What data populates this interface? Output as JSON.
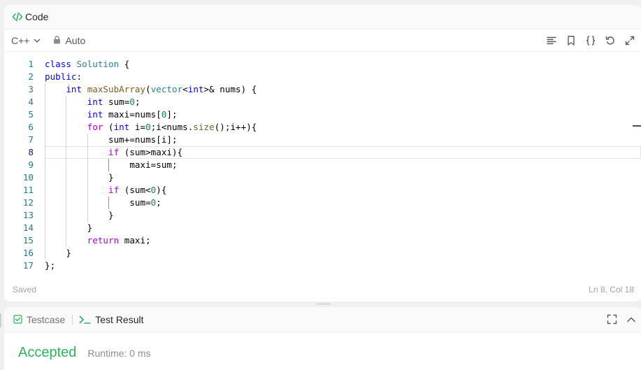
{
  "code_panel": {
    "title": "Code",
    "language": "C++",
    "mode": "Auto",
    "status": "Saved",
    "cursor_position": "Ln 8, Col 18",
    "current_line": 8
  },
  "code_lines": [
    {
      "num": "1",
      "indent": 0,
      "tokens": [
        {
          "t": "class",
          "c": "kw"
        },
        {
          "t": " "
        },
        {
          "t": "Solution",
          "c": "ty"
        },
        {
          "t": " {"
        }
      ]
    },
    {
      "num": "2",
      "indent": 0,
      "tokens": [
        {
          "t": "public",
          "c": "kw"
        },
        {
          "t": ":"
        }
      ]
    },
    {
      "num": "3",
      "indent": 1,
      "tokens": [
        {
          "t": "    "
        },
        {
          "t": "int",
          "c": "kw"
        },
        {
          "t": " "
        },
        {
          "t": "maxSubArray",
          "c": "fn"
        },
        {
          "t": "("
        },
        {
          "t": "vector",
          "c": "ty"
        },
        {
          "t": "<"
        },
        {
          "t": "int",
          "c": "kw"
        },
        {
          "t": ">& nums) {"
        }
      ]
    },
    {
      "num": "4",
      "indent": 2,
      "tokens": [
        {
          "t": "        "
        },
        {
          "t": "int",
          "c": "kw"
        },
        {
          "t": " sum="
        },
        {
          "t": "0",
          "c": "nm"
        },
        {
          "t": ";"
        }
      ]
    },
    {
      "num": "5",
      "indent": 2,
      "tokens": [
        {
          "t": "        "
        },
        {
          "t": "int",
          "c": "kw"
        },
        {
          "t": " maxi=nums["
        },
        {
          "t": "0",
          "c": "nm"
        },
        {
          "t": "];"
        }
      ]
    },
    {
      "num": "6",
      "indent": 2,
      "tokens": [
        {
          "t": "        "
        },
        {
          "t": "for",
          "c": "kwc"
        },
        {
          "t": " ("
        },
        {
          "t": "int",
          "c": "kw"
        },
        {
          "t": " i="
        },
        {
          "t": "0",
          "c": "nm"
        },
        {
          "t": ";i<nums."
        },
        {
          "t": "size",
          "c": "fn"
        },
        {
          "t": "();i++){"
        }
      ]
    },
    {
      "num": "7",
      "indent": 3,
      "tokens": [
        {
          "t": "            "
        },
        {
          "t": "sum+=nums[i];"
        }
      ]
    },
    {
      "num": "8",
      "indent": 3,
      "tokens": [
        {
          "t": "            "
        },
        {
          "t": "if",
          "c": "kwc"
        },
        {
          "t": " (sum>maxi){"
        }
      ]
    },
    {
      "num": "9",
      "indent": 4,
      "tokens": [
        {
          "t": "                "
        },
        {
          "t": "maxi=sum;"
        }
      ]
    },
    {
      "num": "10",
      "indent": 3,
      "tokens": [
        {
          "t": "            "
        },
        {
          "t": "}"
        }
      ]
    },
    {
      "num": "11",
      "indent": 3,
      "tokens": [
        {
          "t": "            "
        },
        {
          "t": "if",
          "c": "kwc"
        },
        {
          "t": " (sum<"
        },
        {
          "t": "0",
          "c": "nm"
        },
        {
          "t": "){"
        }
      ]
    },
    {
      "num": "12",
      "indent": 4,
      "tokens": [
        {
          "t": "                "
        },
        {
          "t": "sum="
        },
        {
          "t": "0",
          "c": "nm"
        },
        {
          "t": ";"
        }
      ]
    },
    {
      "num": "13",
      "indent": 3,
      "tokens": [
        {
          "t": "            "
        },
        {
          "t": "}"
        }
      ]
    },
    {
      "num": "14",
      "indent": 2,
      "tokens": [
        {
          "t": "        "
        },
        {
          "t": "}"
        }
      ]
    },
    {
      "num": "15",
      "indent": 2,
      "tokens": [
        {
          "t": "        "
        },
        {
          "t": "return",
          "c": "kwc"
        },
        {
          "t": " maxi;"
        }
      ]
    },
    {
      "num": "16",
      "indent": 1,
      "tokens": [
        {
          "t": "    "
        },
        {
          "t": "}"
        }
      ]
    },
    {
      "num": "17",
      "indent": 0,
      "tokens": [
        {
          "t": "};"
        }
      ]
    }
  ],
  "result_panel": {
    "tab_testcase": "Testcase",
    "tab_result": "Test Result",
    "verdict": "Accepted",
    "runtime": "Runtime: 0 ms"
  },
  "colors": {
    "accent_green": "#2db55d",
    "keyword_blue": "#0000ff",
    "control_purple": "#af00db",
    "type_teal": "#267f99",
    "function_brown": "#795e26",
    "number_green": "#098658",
    "line_number": "#237893"
  },
  "icons": {
    "code": "code-brackets-icon",
    "language_dropdown": "chevron-down-icon",
    "lock": "lock-icon",
    "format": "format-lines-icon",
    "bookmark": "bookmark-icon",
    "braces": "braces-icon",
    "reset": "undo-icon",
    "expand": "expand-icon",
    "testcase": "checkbox-icon",
    "terminal": "terminal-icon",
    "fullscreen": "fullscreen-icon",
    "collapse": "chevron-up-icon"
  }
}
